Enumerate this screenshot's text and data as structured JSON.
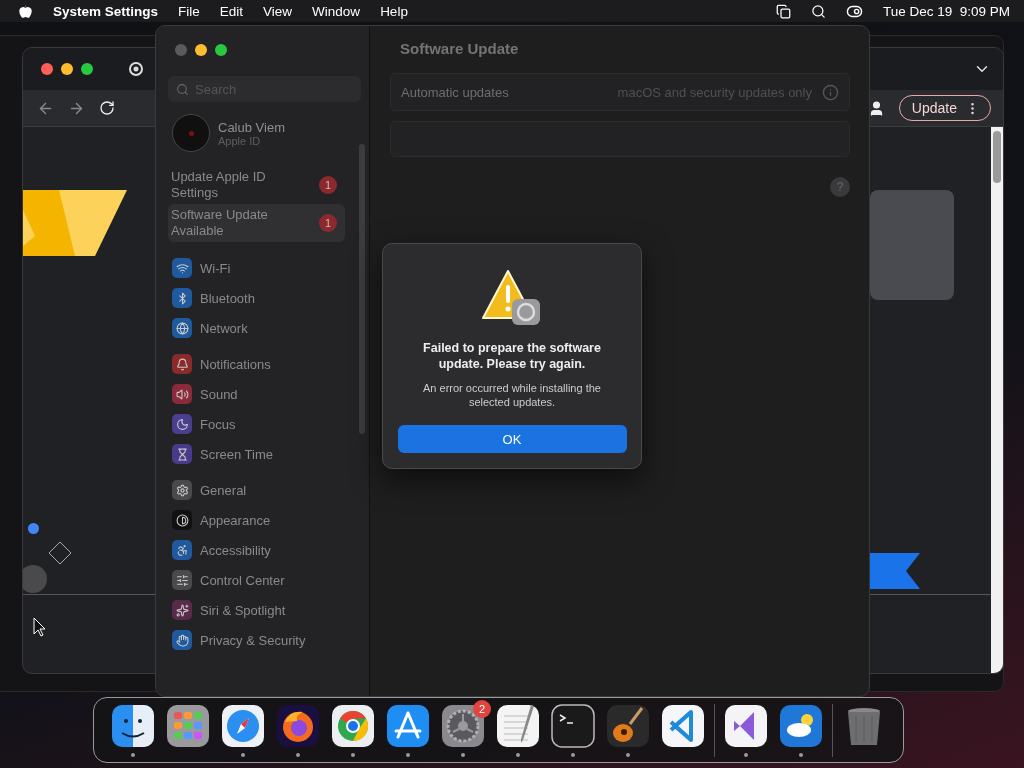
{
  "menu_bar": {
    "app": "System Settings",
    "menus": [
      "File",
      "Edit",
      "View",
      "Window",
      "Help"
    ],
    "clock": "Tue Dec 19  9:09 PM"
  },
  "browser": {
    "update_button": "Update"
  },
  "settings": {
    "search": {
      "placeholder": "Search"
    },
    "account": {
      "name": "Calub Viem",
      "subtitle": "Apple ID"
    },
    "alerts": [
      {
        "label": "Update Apple ID Settings",
        "badge": "1",
        "selected": false
      },
      {
        "label": "Software Update Available",
        "badge": "1",
        "selected": true
      }
    ],
    "groups": [
      {
        "items": [
          {
            "label": "Wi-Fi",
            "kind": "wifi"
          },
          {
            "label": "Bluetooth",
            "kind": "bluetooth"
          },
          {
            "label": "Network",
            "kind": "network"
          }
        ]
      },
      {
        "items": [
          {
            "label": "Notifications",
            "kind": "notifications"
          },
          {
            "label": "Sound",
            "kind": "sound"
          },
          {
            "label": "Focus",
            "kind": "focus"
          },
          {
            "label": "Screen Time",
            "kind": "screentime"
          }
        ]
      },
      {
        "items": [
          {
            "label": "General",
            "kind": "general"
          },
          {
            "label": "Appearance",
            "kind": "appearance"
          },
          {
            "label": "Accessibility",
            "kind": "accessibility"
          },
          {
            "label": "Control Center",
            "kind": "control"
          },
          {
            "label": "Siri & Spotlight",
            "kind": "siri"
          },
          {
            "label": "Privacy & Security",
            "kind": "privacy"
          }
        ]
      }
    ],
    "page": {
      "title": "Software Update",
      "rows": [
        {
          "label": "Automatic updates",
          "value": "macOS and security updates only"
        }
      ],
      "help": "?"
    }
  },
  "dialog": {
    "title": "Failed to prepare the software update. Please try again.",
    "message": "An error occurred while installing the selected updates.",
    "button": "OK"
  },
  "dock": {
    "sections": [
      {
        "items": [
          {
            "kind": "finder",
            "running": true
          },
          {
            "kind": "launchpad",
            "running": false
          },
          {
            "kind": "safari",
            "running": true
          },
          {
            "kind": "firefox",
            "running": true
          },
          {
            "kind": "chrome",
            "running": true
          },
          {
            "kind": "appstore",
            "running": true
          },
          {
            "kind": "settings",
            "running": true,
            "badge": "2"
          },
          {
            "kind": "textedit",
            "running": true
          },
          {
            "kind": "terminal",
            "running": true
          },
          {
            "kind": "garageband",
            "running": true
          },
          {
            "kind": "vscode",
            "running": false
          }
        ]
      },
      {
        "items": [
          {
            "kind": "visualstudio",
            "running": true
          },
          {
            "kind": "weather",
            "running": true
          }
        ]
      },
      {
        "items": [
          {
            "kind": "trash",
            "running": false
          }
        ]
      }
    ]
  }
}
